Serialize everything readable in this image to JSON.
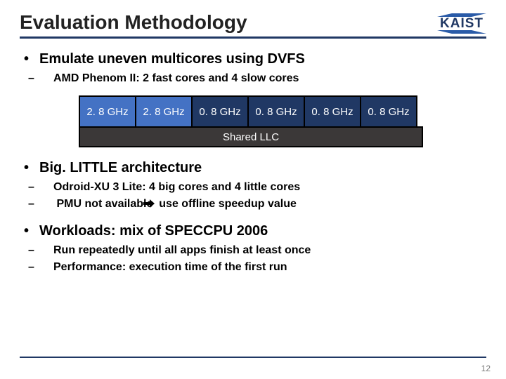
{
  "title": "Evaluation Methodology",
  "logo": {
    "text": "KAIST"
  },
  "bullets": {
    "b1": {
      "head": "Emulate uneven multicores using DVFS",
      "sub1": "AMD Phenom II: 2 fast cores and 4 slow cores"
    },
    "cores": {
      "fast1": "2. 8 GHz",
      "fast2": "2. 8 GHz",
      "slow1": "0. 8 GHz",
      "slow2": "0. 8 GHz",
      "slow3": "0. 8 GHz",
      "slow4": "0. 8 GHz",
      "llc": "Shared LLC"
    },
    "b2": {
      "head": "Big. LITTLE architecture",
      "sub1": "Odroid-XU 3 Lite: 4 big cores and 4 little cores",
      "sub2a": "PMU not available ",
      "sub2b": " use offline speedup value"
    },
    "b3": {
      "head": "Workloads: mix of SPECCPU 2006",
      "sub1": "Run repeatedly until all apps finish at least once",
      "sub2": "Performance: execution time of the first run"
    }
  },
  "page": "12"
}
